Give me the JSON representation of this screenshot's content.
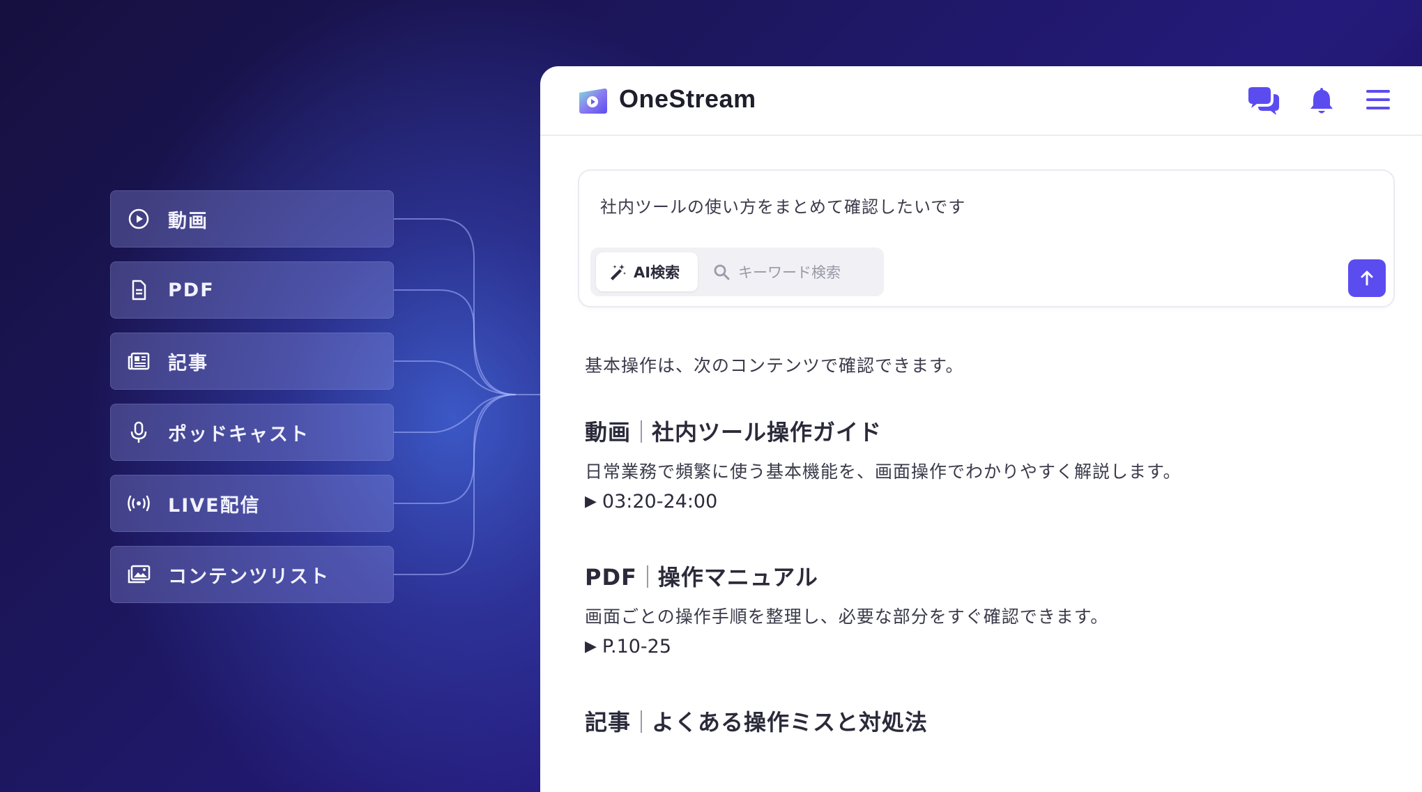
{
  "menu": {
    "items": [
      {
        "label": "動画",
        "icon": "play-circle-icon"
      },
      {
        "label": "PDF",
        "icon": "document-icon"
      },
      {
        "label": "記事",
        "icon": "newspaper-icon"
      },
      {
        "label": "ポッドキャスト",
        "icon": "microphone-icon"
      },
      {
        "label": "LIVE配信",
        "icon": "broadcast-icon"
      },
      {
        "label": "コンテンツリスト",
        "icon": "image-list-icon"
      }
    ]
  },
  "app": {
    "brand": "OneStream",
    "header_icons": [
      "chat-bubbles-icon",
      "bell-icon",
      "hamburger-menu-icon"
    ],
    "accent_color": "#5b4cf0"
  },
  "search": {
    "query": "社内ツールの使い方をまとめて確認したいです",
    "mode_ai_label": "AI検索",
    "mode_keyword_label": "キーワード検索",
    "active_mode": "AI検索"
  },
  "answer": {
    "intro": "基本操作は、次のコンテンツで確認できます。",
    "results": [
      {
        "type": "動画",
        "title": "社内ツール操作ガイド",
        "description": "日常業務で頻繁に使う基本機能を、画面操作でわかりやすく解説します。",
        "meta": "03:20-24:00"
      },
      {
        "type": "PDF",
        "title": "操作マニュアル",
        "description": "画面ごとの操作手順を整理し、必要な部分をすぐ確認できます。",
        "meta": "P.10-25"
      },
      {
        "type": "記事",
        "title": "よくある操作ミスと対処法"
      }
    ]
  }
}
